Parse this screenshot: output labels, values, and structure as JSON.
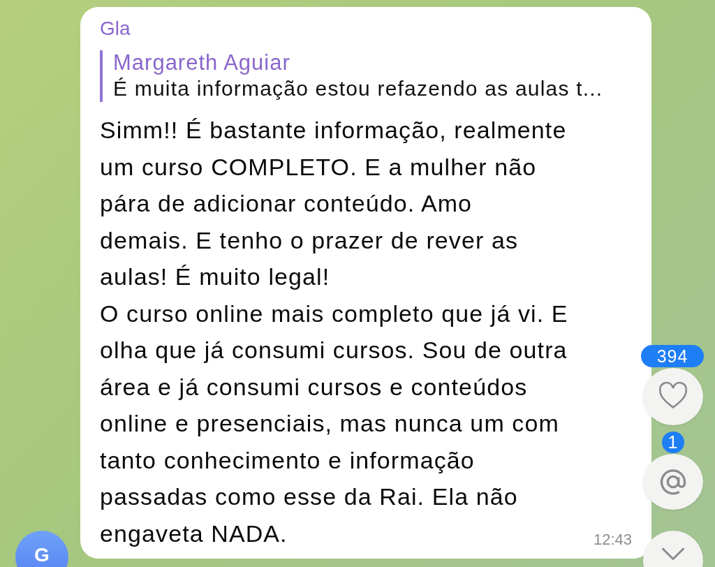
{
  "message": {
    "sender": "Gla",
    "reply": {
      "author": "Margareth Aguiar",
      "text": "É muita informação estou refazendo as aulas t..."
    },
    "paragraphs": [
      "Simm!! É bastante informação, realmente\num curso COMPLETO. E a mulher não\npára de adicionar conteúdo. Amo\ndemais. E tenho o prazer de rever as\naulas! É muito legal!",
      "O curso online mais completo que já vi. E\nolha que já consumi cursos. Sou de outra\nárea e já consumi cursos e conteúdos\nonline e presenciais, mas nunca um com\ntanto conhecimento e informação\npassadas como esse da Rai. Ela não\nengaveta NADA."
    ],
    "time": "12:43"
  },
  "avatar": {
    "initial": "G"
  },
  "floating_buttons": [
    {
      "kind": "reactions",
      "count": "394"
    },
    {
      "kind": "mentions",
      "count": "1"
    },
    {
      "kind": "scroll_down"
    }
  ]
}
